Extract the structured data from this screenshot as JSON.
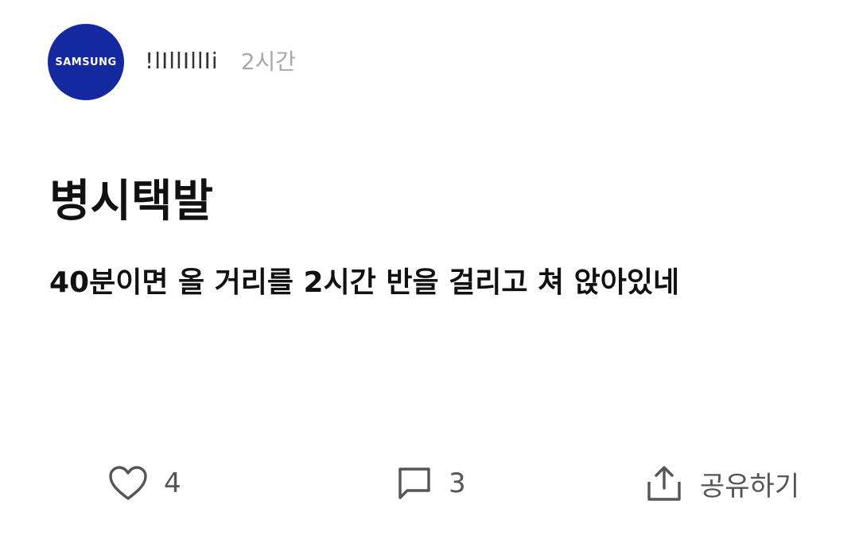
{
  "post": {
    "author": {
      "avatar_logo_text": "SAMSUNG",
      "avatar_color": "#1428a0",
      "username": "!lIllIllIi",
      "time": "2시간"
    },
    "title": "병시택발",
    "body": "40분이면 올 거리를 2시간 반을 걸리고 쳐 앉아있네",
    "actions": {
      "like": {
        "icon": "heart-icon",
        "count": "4"
      },
      "comment": {
        "icon": "comment-icon",
        "count": "3"
      },
      "share": {
        "icon": "share-icon",
        "label": "공유하기"
      }
    }
  }
}
